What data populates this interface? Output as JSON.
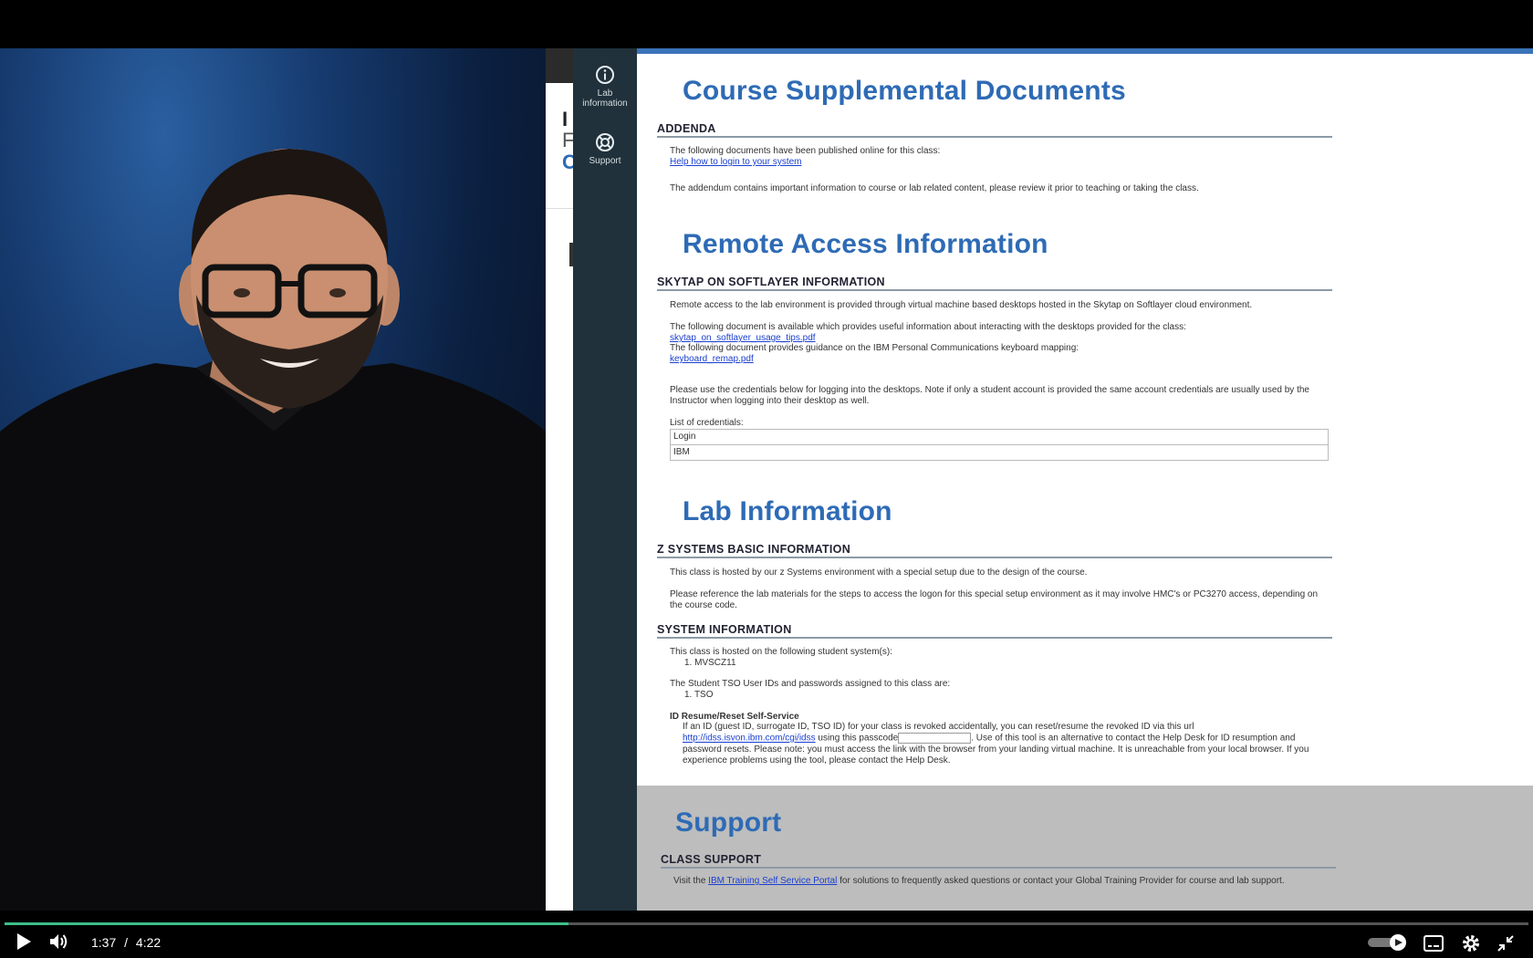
{
  "player": {
    "current_time": "1:37",
    "separator": "/",
    "duration": "4:22",
    "progress_fraction": 0.37,
    "accent": "#3dbf8a"
  },
  "rail": {
    "items": [
      {
        "label_line1": "Lab",
        "label_line2": "information",
        "icon": "info-icon"
      },
      {
        "label_line1": "Support",
        "label_line2": "",
        "icon": "lifebuoy-icon"
      }
    ]
  },
  "behind_chars": [
    "I",
    "F",
    "C"
  ],
  "doc": {
    "course": {
      "title": "Course Supplemental Documents",
      "subheading": "ADDENDA",
      "intro": "The following documents have been published online for this class:",
      "link": "Help how to login to your system",
      "note": "The addendum contains important information to course or lab related content, please review it prior to teaching or taking the class."
    },
    "remote": {
      "title": "Remote Access Information",
      "subheading": "SKYTAP ON SOFTLAYER INFORMATION",
      "p1": "Remote access to the lab environment is provided through virtual machine based desktops hosted in the Skytap on Softlayer cloud environment.",
      "p2": "The following document is available which provides useful information about interacting with the desktops provided for the class:",
      "link1": "skytap_on_softlayer_usage_tips.pdf",
      "p3": "The following document provides guidance on the IBM Personal Communications keyboard mapping:",
      "link2": "keyboard_remap.pdf",
      "p4": "Please use the credentials below for logging into the desktops. Note if only a student account is provided the same account credentials are usually used by the Instructor when logging into their desktop as well.",
      "cred_label": "List of credentials:",
      "table_rows": [
        "Login",
        "IBM"
      ]
    },
    "lab": {
      "title": "Lab Information",
      "subheading": "Z SYSTEMS BASIC INFORMATION",
      "p1": "This class is hosted by our z Systems environment with a special setup due to the design of the course.",
      "p2": "Please reference the lab materials for the steps to access the logon for this special setup environment as it may involve HMC's or PC3270 access, depending on the course code.",
      "sys_subheading": "SYSTEM INFORMATION",
      "sys_p1": "This class is hosted on the following student system(s):",
      "sys_item": "1.  MVSCZ11",
      "sys_p2": "The Student TSO User IDs and passwords assigned to this class are:",
      "sys_item2": "1.  TSO",
      "id_heading": "ID Resume/Reset Self-Service",
      "id_p1": "If an ID (guest ID, surrogate ID, TSO ID) for your class is revoked accidentally, you can reset/resume the revoked ID via this url",
      "id_link": "http://idss.isvon.ibm.com/cgi/idss",
      "id_p2a": "using this passcode",
      "id_p2b": ". Use of this tool is an alternative to contact the Help Desk for ID resumption and password resets. Please note: you must access the link with the browser from your landing virtual machine. It is unreachable from your local browser. If you experience problems using the tool, please contact the Help Desk."
    },
    "support": {
      "title": "Support",
      "subheading": "CLASS SUPPORT",
      "p_pre": "Visit the",
      "link": "IBM Training Self Service Portal",
      "p_post": "for solutions to frequently asked questions or contact your Global Training Provider for course and lab support."
    }
  }
}
